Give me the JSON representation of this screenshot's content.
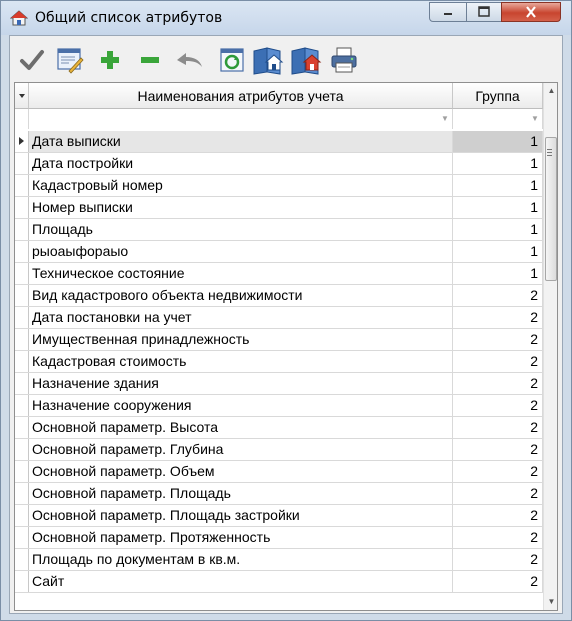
{
  "window": {
    "title": "Общий список атрибутов",
    "controls": {
      "minimize_icon": "minimize-icon",
      "maximize_icon": "maximize-icon",
      "close_icon": "close-icon"
    }
  },
  "toolbar": {
    "buttons": [
      {
        "name": "apply-button",
        "icon": "checkmark-icon"
      },
      {
        "name": "edit-button",
        "icon": "edit-form-icon"
      },
      {
        "name": "add-button",
        "icon": "plus-icon"
      },
      {
        "name": "remove-button",
        "icon": "minus-icon"
      },
      {
        "name": "undo-button",
        "icon": "undo-arrow-icon"
      },
      {
        "name": "refresh-button",
        "icon": "refresh-window-icon"
      },
      {
        "name": "book-export-button",
        "icon": "book-house-blue-icon"
      },
      {
        "name": "book-import-button",
        "icon": "book-house-red-icon"
      },
      {
        "name": "print-button",
        "icon": "printer-icon"
      }
    ]
  },
  "grid": {
    "columns": {
      "name": "Наименования атрибутов учета",
      "group": "Группа"
    },
    "rows": [
      {
        "name": "Дата выписки",
        "group": "1"
      },
      {
        "name": "Дата постройки",
        "group": "1"
      },
      {
        "name": "Кадастровый номер",
        "group": "1"
      },
      {
        "name": "Номер выписки",
        "group": "1"
      },
      {
        "name": "Площадь",
        "group": "1"
      },
      {
        "name": "рыоаыфораыо",
        "group": "1"
      },
      {
        "name": "Техническое состояние",
        "group": "1"
      },
      {
        "name": "Вид кадастрового объекта недвижимости",
        "group": "2"
      },
      {
        "name": "Дата постановки на учет",
        "group": "2"
      },
      {
        "name": "Имущественная принадлежность",
        "group": "2"
      },
      {
        "name": "Кадастровая стоимость",
        "group": "2"
      },
      {
        "name": "Назначение здания",
        "group": "2"
      },
      {
        "name": "Назначение сооружения",
        "group": "2"
      },
      {
        "name": "Основной параметр. Высота",
        "group": "2"
      },
      {
        "name": "Основной параметр. Глубина",
        "group": "2"
      },
      {
        "name": "Основной параметр. Объем",
        "group": "2"
      },
      {
        "name": "Основной параметр. Площадь",
        "group": "2"
      },
      {
        "name": "Основной параметр. Площадь застройки",
        "group": "2"
      },
      {
        "name": "Основной параметр. Протяженность",
        "group": "2"
      },
      {
        "name": "Площадь по документам в кв.м.",
        "group": "2"
      },
      {
        "name": "Сайт",
        "group": "2"
      }
    ]
  }
}
